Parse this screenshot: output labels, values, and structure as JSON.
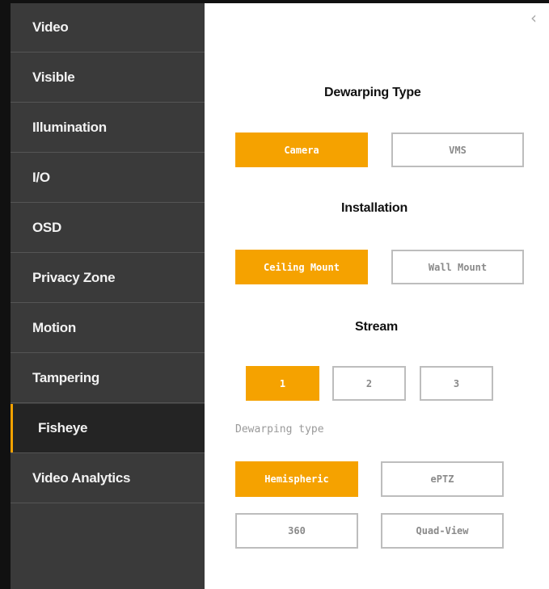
{
  "sidebar": {
    "items": [
      {
        "label": "Video"
      },
      {
        "label": "Visible"
      },
      {
        "label": "Illumination"
      },
      {
        "label": "I/O"
      },
      {
        "label": "OSD"
      },
      {
        "label": "Privacy Zone"
      },
      {
        "label": "Motion"
      },
      {
        "label": "Tampering"
      },
      {
        "label": "Fisheye"
      },
      {
        "label": "Video Analytics"
      }
    ],
    "active": "Fisheye",
    "accent_color": "#f5a200"
  },
  "main": {
    "collapse_icon": "chevron-left-icon",
    "dewarping_type": {
      "title": "Dewarping Type",
      "options": [
        "Camera",
        "VMS"
      ],
      "selected": "Camera"
    },
    "installation": {
      "title": "Installation",
      "options": [
        "Ceiling Mount",
        "Wall Mount"
      ],
      "selected": "Ceiling Mount"
    },
    "stream": {
      "title": "Stream",
      "options": [
        "1",
        "2",
        "3"
      ],
      "selected": "1"
    },
    "dewarping_mode": {
      "label": "Dewarping type",
      "options": [
        "Hemispheric",
        "ePTZ",
        "360",
        "Quad-View"
      ],
      "selected": "Hemispheric"
    }
  }
}
